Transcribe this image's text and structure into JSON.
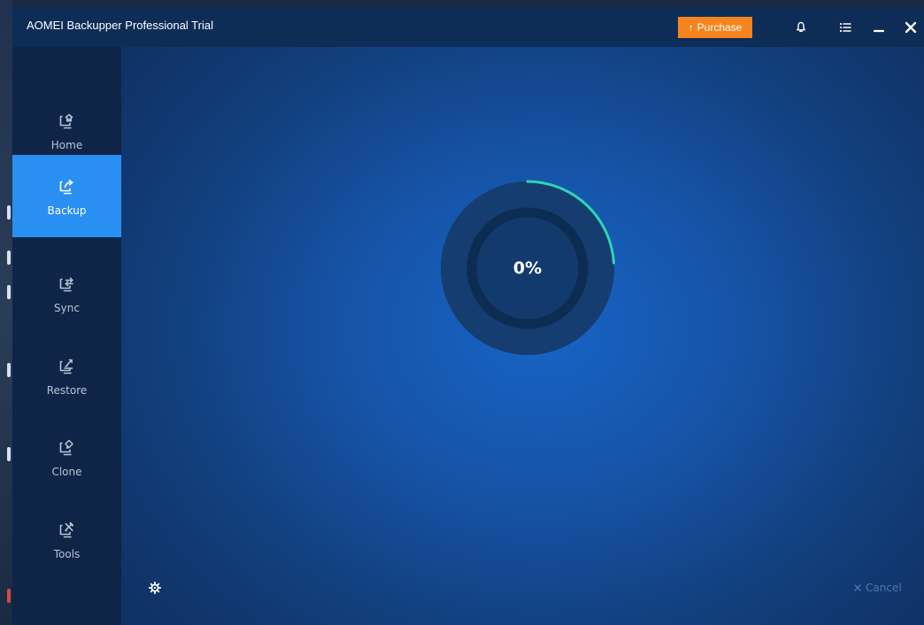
{
  "app": {
    "title": "AOMEI Backupper Professional Trial"
  },
  "titlebar": {
    "purchase_label": "Purchase",
    "icons": [
      "bell-icon",
      "menu-icon",
      "minimize-icon",
      "close-icon"
    ]
  },
  "sidebar": {
    "items": [
      {
        "label": "Home",
        "icon": "home-icon",
        "active": false
      },
      {
        "label": "Backup",
        "icon": "backup-icon",
        "active": true
      },
      {
        "label": "Sync",
        "icon": "sync-icon",
        "active": false
      },
      {
        "label": "Restore",
        "icon": "restore-icon",
        "active": false
      },
      {
        "label": "Clone",
        "icon": "clone-icon",
        "active": false
      },
      {
        "label": "Tools",
        "icon": "tools-icon",
        "active": false
      }
    ]
  },
  "progress": {
    "percent_label": "0%",
    "value_percent": 0
  },
  "footer": {
    "cancel_label": "Cancel",
    "settings_icon": "gear-icon"
  },
  "colors": {
    "purchase": "#f5841f",
    "active_nav": "#2a8ff2",
    "sidebar": "#0e2548",
    "progress_arc": "#2fd5b1"
  }
}
